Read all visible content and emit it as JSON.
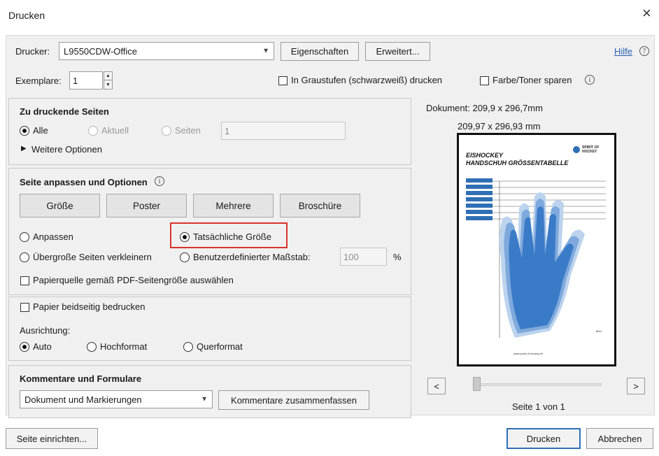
{
  "window": {
    "title": "Drucken",
    "close_glyph": "×"
  },
  "top": {
    "printer_label": "Drucker:",
    "printer_value": "L9550CDW-Office",
    "properties_button": "Eigenschaften",
    "advanced_button": "Erweitert...",
    "help_link": "Hilfe",
    "copies_label": "Exemplare:",
    "copies_value": "1",
    "grayscale_label": "In Graustufen (schwarzweiß) drucken",
    "grayscale_checked": false,
    "save_toner_label": "Farbe/Toner sparen",
    "save_toner_checked": false
  },
  "pages_section": {
    "heading": "Zu druckende Seiten",
    "all_label": "Alle",
    "current_label": "Aktuell",
    "pages_label": "Seiten",
    "pages_value": "1",
    "selected": "Alle",
    "more_options": "Weitere Optionen"
  },
  "sizing_section": {
    "heading": "Seite anpassen und Optionen",
    "tabs": [
      "Größe",
      "Poster",
      "Mehrere",
      "Broschüre"
    ],
    "fit_label": "Anpassen",
    "actual_size_label": "Tatsächliche Größe",
    "shrink_label": "Übergroße Seiten verkleinern",
    "custom_scale_label": "Benutzerdefinierter Maßstab:",
    "custom_scale_value": "100",
    "percent": "%",
    "selected": "Tatsächliche Größe",
    "paper_source_label": "Papierquelle gemäß PDF-Seitengröße auswählen",
    "paper_source_checked": false
  },
  "duplex_section": {
    "duplex_label": "Papier beidseitig bedrucken",
    "duplex_checked": false,
    "orientation_label": "Ausrichtung:",
    "auto_label": "Auto",
    "portrait_label": "Hochformat",
    "landscape_label": "Querformat",
    "selected": "Auto"
  },
  "comments_section": {
    "heading": "Kommentare und Formulare",
    "select_value": "Dokument und Markierungen",
    "summarize_button": "Kommentare zusammenfassen"
  },
  "preview": {
    "document_size": "Dokument: 209,9 x 296,7mm",
    "paper_size": "209,97 x 296,93 mm",
    "doc_title_line1": "EISHOCKEY",
    "doc_title_line2": "HANDSCHUH GRÖSSENTABELLE",
    "logo_text_1": "SPIRIT OF",
    "logo_text_2": "HOCKEY",
    "footer_url": "www.spirit-of-hockey.de",
    "size_marker": "M19",
    "prev_button": "<",
    "next_button": ">",
    "page_indicator": "Seite 1 von 1",
    "page_position": 0
  },
  "bottom": {
    "page_setup_button": "Seite einrichten...",
    "print_button": "Drucken",
    "cancel_button": "Abbrechen"
  },
  "colors": {
    "accent_blue": "#2f6fb5",
    "highlight_red": "#d9342b",
    "hand_blue": "#3a7bc8"
  }
}
